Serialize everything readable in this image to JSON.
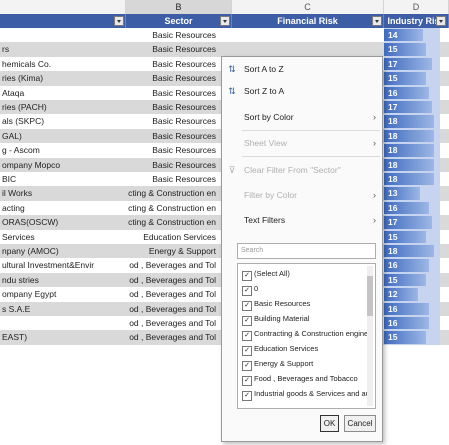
{
  "columns": {
    "letters": [
      "B",
      "C",
      "D"
    ],
    "fields": [
      "Sector",
      "Financial Risk",
      "Industry Risk"
    ]
  },
  "rows": [
    {
      "company": "",
      "sector": "Basic Resources",
      "industry_risk": "14"
    },
    {
      "company": "rs",
      "sector": "Basic Resources",
      "industry_risk": "15"
    },
    {
      "company": "hemicals Co.",
      "sector": "Basic Resources",
      "industry_risk": "17"
    },
    {
      "company": "ries (Kima)",
      "sector": "Basic Resources",
      "industry_risk": "15"
    },
    {
      "company": "Ataqa",
      "sector": "Basic Resources",
      "industry_risk": "16"
    },
    {
      "company": "ries (PACH)",
      "sector": "Basic Resources",
      "industry_risk": "17"
    },
    {
      "company": "als (SKPC)",
      "sector": "Basic Resources",
      "industry_risk": "18"
    },
    {
      "company": "GAL)",
      "sector": "Basic Resources",
      "industry_risk": "18"
    },
    {
      "company": "g - Ascom",
      "sector": "Basic Resources",
      "industry_risk": "18"
    },
    {
      "company": "ompany Mopco",
      "sector": "Basic Resources",
      "industry_risk": "18"
    },
    {
      "company": "BIC",
      "sector": "Basic Resources",
      "industry_risk": "18"
    },
    {
      "company": "il Works",
      "sector": "cting & Construction en",
      "industry_risk": "13"
    },
    {
      "company": "acting",
      "sector": "cting & Construction en",
      "industry_risk": "16"
    },
    {
      "company": "ORAS(OSCW)",
      "sector": "cting & Construction en",
      "industry_risk": "17"
    },
    {
      "company": " Services",
      "sector": "Education Services",
      "industry_risk": "15"
    },
    {
      "company": "npany (AMOC)",
      "sector": "Energy & Support",
      "industry_risk": "18"
    },
    {
      "company": "ultural Investment&Envir",
      "sector": "od , Beverages and Tol",
      "industry_risk": "16"
    },
    {
      "company": "ndu stries",
      "sector": "od , Beverages and Tol",
      "industry_risk": "15"
    },
    {
      "company": "ompany Egypt",
      "sector": "od , Beverages and Tol",
      "industry_risk": "12"
    },
    {
      "company": "s S.A.E",
      "sector": "od , Beverages and Tol",
      "industry_risk": "16"
    },
    {
      "company": "",
      "sector": "od , Beverages and Tol",
      "industry_risk": "16"
    },
    {
      "company": "EAST)",
      "sector": "od , Beverages and Tol",
      "industry_risk": "15"
    }
  ],
  "filter_menu": {
    "sort_asc": "Sort A to Z",
    "sort_desc": "Sort Z to A",
    "sort_by_color": "Sort by Color",
    "sheet_view": "Sheet View",
    "clear_filter": "Clear Filter From \"Sector\"",
    "filter_by_color": "Filter by Color",
    "text_filters": "Text Filters",
    "search_placeholder": "Search",
    "items": [
      "(Select All)",
      "0",
      "Basic Resources",
      "Building Material",
      "Contracting & Construction engine",
      "Education Services",
      "Energy & Support",
      "Food , Beverages and Tobacco",
      "Industrial goods & Services and au"
    ],
    "ok": "OK",
    "cancel": "Cancel"
  },
  "colors": {
    "header_fill": "#3d5ea6",
    "band_fill": "#d9d9d9",
    "databar": "#3f6bbf"
  },
  "icons": [
    "sort-asc-icon",
    "sort-desc-icon",
    "clear-filter-icon",
    "chevron-right-icon",
    "filter-dropdown-icon"
  ]
}
